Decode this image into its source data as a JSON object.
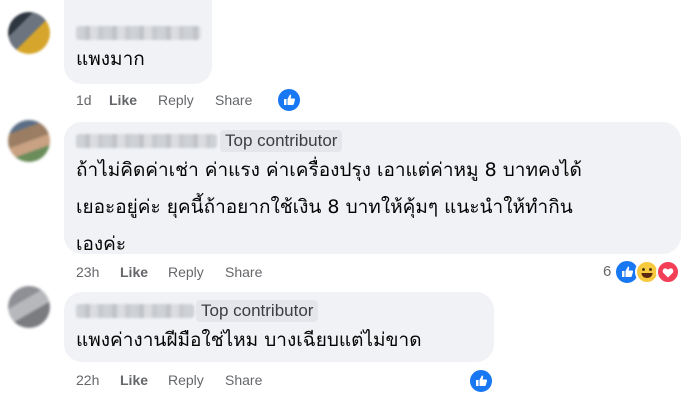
{
  "comments": [
    {
      "text_lines": [
        "แพงมาก"
      ],
      "age": "1d",
      "like": "Like",
      "reply": "Reply",
      "share": "Share"
    },
    {
      "badge": "Top contributor",
      "text_lines": [
        "ถ้าไม่คิดค่าเช่า ค่าแรง ค่าเครื่องปรุง เอาแต่ค่าหมู 8 บาทคงได้",
        "เยอะอยู่ค่ะ ยุคนี้ถ้าอยากใช้เงิน 8 บาทให้คุ้มๆ แนะนำให้ทำกิน",
        "เองค่ะ"
      ],
      "age": "23h",
      "like": "Like",
      "reply": "Reply",
      "share": "Share",
      "reaction_count": "6"
    },
    {
      "badge": "Top contributor",
      "text_lines": [
        "แพงค่างานฝีมือใช่ไหม บางเฉียบแต่ไม่ขาด"
      ],
      "age": "22h",
      "like": "Like",
      "reply": "Reply",
      "share": "Share"
    }
  ]
}
